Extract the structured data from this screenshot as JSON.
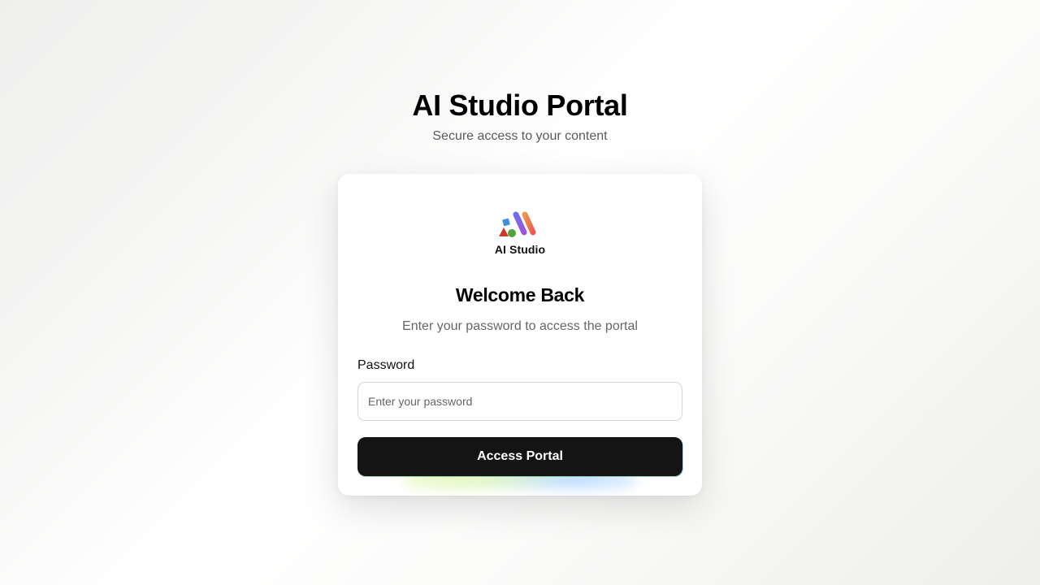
{
  "header": {
    "title": "AI Studio Portal",
    "subtitle": "Secure access to your content"
  },
  "card": {
    "logo": {
      "icon": "ai-studio-logo-icon",
      "text": "AI Studio"
    },
    "welcome_title": "Welcome Back",
    "welcome_subtitle": "Enter your password to access the portal",
    "password": {
      "label": "Password",
      "placeholder": "Enter your password",
      "value": ""
    },
    "submit_label": "Access Portal"
  },
  "colors": {
    "button_background": "#141414",
    "card_background": "#ffffff",
    "logo_triangle": "#d0382b",
    "logo_square": "#3e8ed9",
    "logo_circle": "#4ea33a",
    "logo_stroke_purple": "#8a5ee8",
    "logo_stroke_orange": "#f27a45"
  }
}
